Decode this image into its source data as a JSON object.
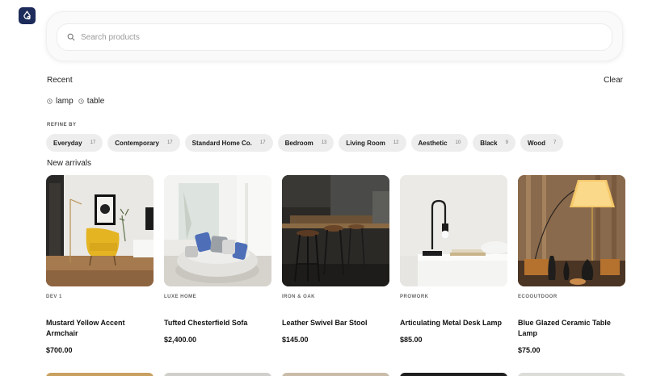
{
  "search": {
    "placeholder": "Search products",
    "value": ""
  },
  "recent": {
    "title": "Recent",
    "clear_label": "Clear",
    "items": [
      "lamp",
      "table"
    ]
  },
  "refine": {
    "title": "REFINE BY",
    "chips": [
      {
        "label": "Everyday",
        "count": "17"
      },
      {
        "label": "Contemporary",
        "count": "17"
      },
      {
        "label": "Standard Home Co.",
        "count": "17"
      },
      {
        "label": "Bedroom",
        "count": "13"
      },
      {
        "label": "Living Room",
        "count": "12"
      },
      {
        "label": "Aesthetic",
        "count": "10"
      },
      {
        "label": "Black",
        "count": "9"
      },
      {
        "label": "Wood",
        "count": "7"
      }
    ]
  },
  "arrivals": {
    "title": "New arrivals",
    "products": [
      {
        "brand": "DEV 1",
        "name": "Mustard Yellow Accent Armchair",
        "price": "$700.00"
      },
      {
        "brand": "LUXE HOME",
        "name": "Tufted Chesterfield Sofa",
        "price": "$2,400.00"
      },
      {
        "brand": "IRON & OAK",
        "name": "Leather Swivel Bar Stool",
        "price": "$145.00"
      },
      {
        "brand": "PROWORK",
        "name": "Articulating Metal Desk Lamp",
        "price": "$85.00"
      },
      {
        "brand": "ECOOUTDOOR",
        "name": "Blue Glazed Ceramic Table Lamp",
        "price": "$75.00"
      }
    ]
  },
  "colors": {
    "logo_bg": "#1c2b5a",
    "chip_bg": "#ededed"
  }
}
